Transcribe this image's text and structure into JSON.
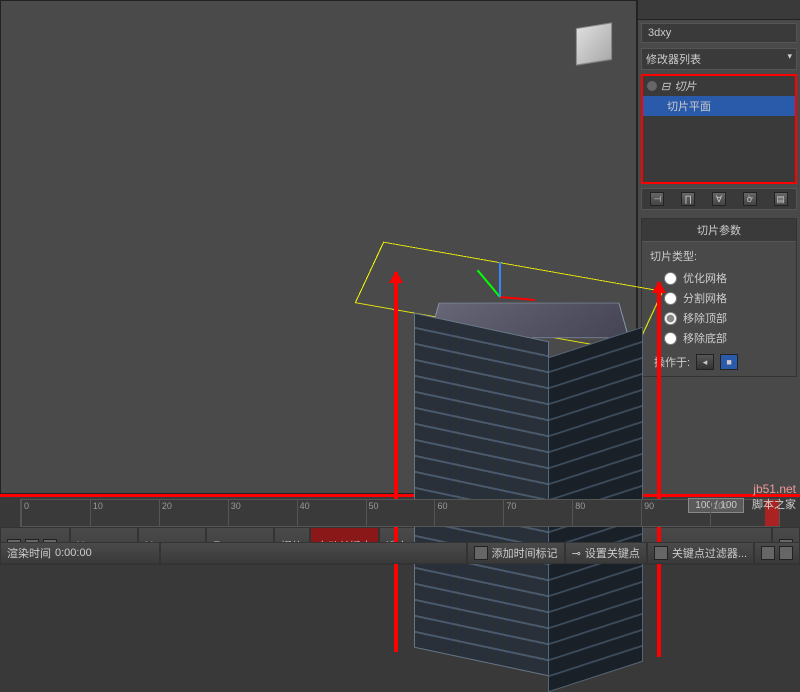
{
  "panel": {
    "object_name": "3dxy",
    "modifier_list_label": "修改器列表",
    "stack": {
      "modifier_name": "切片",
      "sub_object": "切片平面"
    },
    "rollout": {
      "title": "切片参数",
      "type_label": "切片类型:",
      "options": {
        "optimize": "优化网格",
        "split": "分割网格",
        "remove_top": "移除顶部",
        "remove_bottom": "移除底部"
      },
      "operate_label": "操作于:"
    }
  },
  "timeline": {
    "frame_indicator": "100 / 100",
    "ticks": [
      "0",
      "10",
      "20",
      "30",
      "40",
      "50",
      "60",
      "70",
      "80",
      "90",
      "100"
    ],
    "x_label": "X:",
    "y_label": "Y:",
    "z_label": "Z:",
    "grid_label": "栅格",
    "auto_key": "自动关键点",
    "selected_obj": "选定对象",
    "render_time_label": "渲染时间",
    "render_time_value": "0:00:00",
    "add_time_tag": "添加时间标记",
    "set_key": "设置关键点",
    "key_filter": "关键点过滤器..."
  },
  "watermark": {
    "line1": "jb51.net",
    "line2": "脚本之家"
  }
}
